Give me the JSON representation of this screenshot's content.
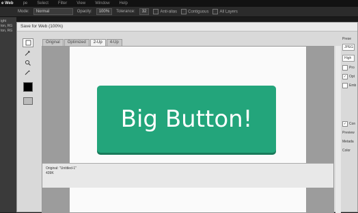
{
  "app": {
    "menu": [
      "e Web",
      "pe",
      "Select",
      "Filter",
      "View",
      "Window",
      "Help"
    ]
  },
  "options": {
    "mode_label": "Mode:",
    "mode_value": "Normal",
    "opacity_label": "Opacity:",
    "opacity_value": "100%",
    "tolerance_label": "Tolerance:",
    "tolerance_value": "32",
    "antialias": "Anti-alias",
    "contiguous": "Contiguous",
    "all_layers": "All Layers"
  },
  "left_strip": [
    "ight",
    "ton, RG",
    "ton, RG"
  ],
  "dialog": {
    "title": "Save for Web (100%)",
    "tabs": [
      "Original",
      "Optimized",
      "2-Up",
      "4-Up"
    ],
    "active_tab": "2-Up",
    "button_text": "Big Button!",
    "button_color": "#23a57b",
    "info_line1": "Original: \"Untitled-1\"",
    "info_line2": "439K"
  },
  "right_panel": {
    "preset_label": "Prese",
    "format": "JPEG",
    "quality": "High",
    "opt1": "Pro",
    "opt2": "Opt",
    "opt3": "Emb",
    "opt4": "Con",
    "preview": "Preview",
    "metadata": "Metada",
    "color": "Color"
  }
}
